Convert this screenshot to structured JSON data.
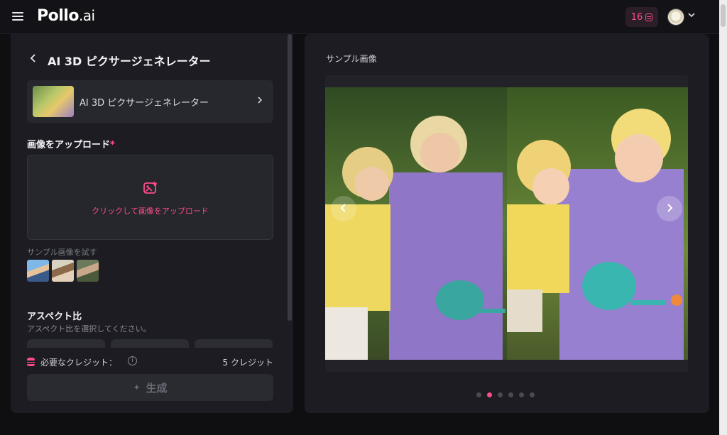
{
  "header": {
    "logo_main": "Pollo",
    "logo_suffix": ".ai",
    "credits": "16",
    "icons": {
      "menu": "hamburger-icon",
      "coin": "coin-stack-icon",
      "chevron": "chevron-down-icon"
    }
  },
  "left_panel": {
    "title": "AI 3D ピクサージェネレーター",
    "tool_card_label": "AI 3D ピクサージェネレーター",
    "upload_label": "画像をアップロード",
    "required_mark": "*",
    "upload_hint": "クリックして画像をアップロード",
    "sample_try_label": "サンプル画像を試す",
    "aspect_label": "アスペクト比",
    "aspect_sub": "アスペクト比を選択してください。",
    "cost_label": "必要なクレジット：",
    "cost_value": "5 クレジット",
    "generate_label": "生成"
  },
  "right_panel": {
    "title": "サンプル画像",
    "carousel": {
      "slide_count": 6,
      "active_index": 1
    }
  },
  "colors": {
    "accent": "#ff4d8a",
    "panel_bg": "#1c1c22",
    "page_bg": "#0f0f12"
  }
}
